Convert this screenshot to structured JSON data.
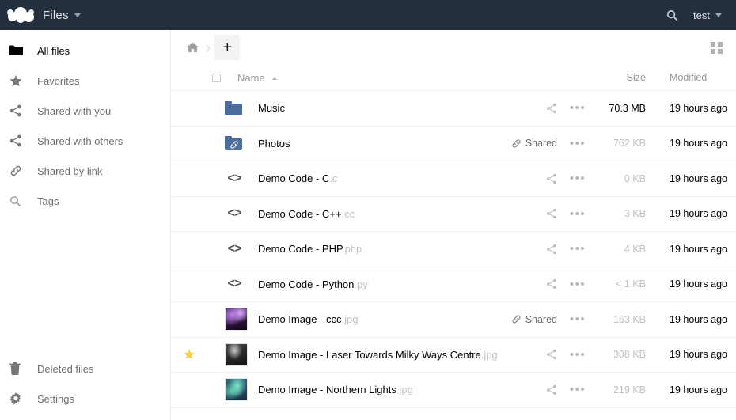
{
  "header": {
    "app_title": "Files",
    "app_title_caret": "dropdown-caret",
    "search_icon": "search-icon",
    "user_label": "test",
    "logo": "owncloud-logo"
  },
  "sidebar": {
    "top_items": [
      {
        "label": "All files",
        "icon": "folder-icon",
        "active": true
      },
      {
        "label": "Favorites",
        "icon": "star-icon",
        "active": false
      },
      {
        "label": "Shared with you",
        "icon": "share-icon",
        "active": false
      },
      {
        "label": "Shared with others",
        "icon": "share-icon",
        "active": false
      },
      {
        "label": "Shared by link",
        "icon": "link-icon",
        "active": false
      },
      {
        "label": "Tags",
        "icon": "tag-search-icon",
        "active": false
      }
    ],
    "bottom_items": [
      {
        "label": "Deleted files",
        "icon": "trash-icon"
      },
      {
        "label": "Settings",
        "icon": "gear-icon"
      }
    ]
  },
  "controls": {
    "home_icon": "home-icon",
    "breadcrumb_separator": "›",
    "new_button_label": "+",
    "grid_toggle_icon": "grid-view-icon"
  },
  "table": {
    "headers": {
      "select_all": "select-all-checkbox",
      "name": "Name",
      "sort_direction": "ascending",
      "size": "Size",
      "modified": "Modified"
    },
    "rows": [
      {
        "name": "Music",
        "ext": "",
        "icon": "folder-icon",
        "thumb": "",
        "favorite": false,
        "shared_label": "",
        "share_action": "share-icon",
        "menu": "•••",
        "size": "70.3 MB",
        "size_dark": true,
        "modified": "19 hours ago"
      },
      {
        "name": "Photos",
        "ext": "",
        "icon": "folder-link-icon",
        "thumb": "",
        "favorite": false,
        "shared_label": "Shared",
        "share_action": "",
        "menu": "•••",
        "size": "762 KB",
        "size_dark": false,
        "modified": "19 hours ago"
      },
      {
        "name": "Demo Code - C",
        "ext": ".c",
        "icon": "code-icon",
        "thumb": "",
        "favorite": false,
        "shared_label": "",
        "share_action": "share-icon",
        "menu": "•••",
        "size": "0 KB",
        "size_dark": false,
        "modified": "19 hours ago"
      },
      {
        "name": "Demo Code - C++",
        "ext": ".cc",
        "icon": "code-icon",
        "thumb": "",
        "favorite": false,
        "shared_label": "",
        "share_action": "share-icon",
        "menu": "•••",
        "size": "3 KB",
        "size_dark": false,
        "modified": "19 hours ago"
      },
      {
        "name": "Demo Code - PHP",
        "ext": ".php",
        "icon": "code-icon",
        "thumb": "",
        "favorite": false,
        "shared_label": "",
        "share_action": "share-icon",
        "menu": "•••",
        "size": "4 KB",
        "size_dark": false,
        "modified": "19 hours ago"
      },
      {
        "name": "Demo Code - Python",
        "ext": ".py",
        "icon": "code-icon",
        "thumb": "",
        "favorite": false,
        "shared_label": "",
        "share_action": "share-icon",
        "menu": "•••",
        "size": "< 1 KB",
        "size_dark": false,
        "modified": "19 hours ago"
      },
      {
        "name": "Demo Image - ccc",
        "ext": ".jpg",
        "icon": "image-thumbnail",
        "thumb": "t-purple",
        "favorite": false,
        "shared_label": "Shared",
        "share_action": "",
        "menu": "•••",
        "size": "163 KB",
        "size_dark": false,
        "modified": "19 hours ago"
      },
      {
        "name": "Demo Image - Laser Towards Milky Ways Centre",
        "ext": ".jpg",
        "icon": "image-thumbnail",
        "thumb": "t-dark",
        "favorite": true,
        "shared_label": "",
        "share_action": "share-icon",
        "menu": "•••",
        "size": "308 KB",
        "size_dark": false,
        "modified": "19 hours ago"
      },
      {
        "name": "Demo Image - Northern Lights",
        "ext": ".jpg",
        "icon": "image-thumbnail",
        "thumb": "t-teal",
        "favorite": false,
        "shared_label": "",
        "share_action": "share-icon",
        "menu": "•••",
        "size": "219 KB",
        "size_dark": false,
        "modified": "19 hours ago"
      }
    ]
  },
  "colors": {
    "header_bg": "#232f3e",
    "folder_blue": "#4b6e9c",
    "favorite_star": "#f5cf47",
    "muted_text": "#c0c0c0"
  }
}
